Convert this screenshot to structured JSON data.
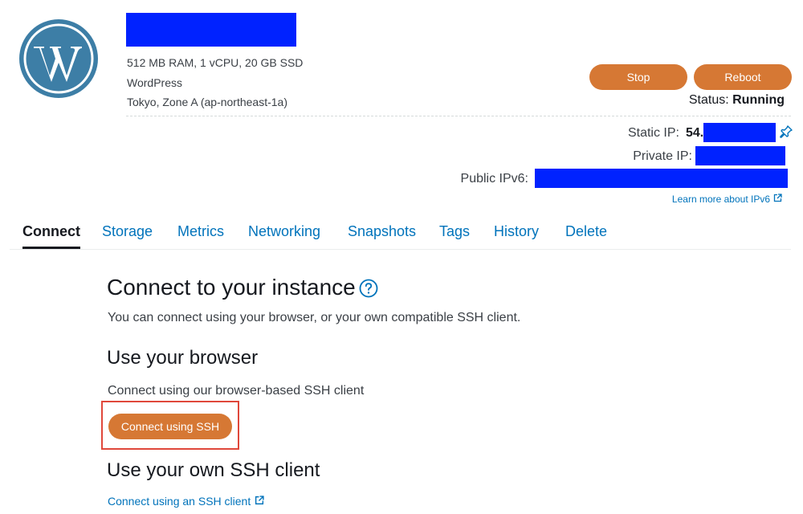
{
  "instance": {
    "specs": "512 MB RAM, 1 vCPU, 20 GB SSD",
    "blueprint": "WordPress",
    "location": "Tokyo, Zone A (ap-northeast-1a)"
  },
  "actions": {
    "stop_label": "Stop",
    "reboot_label": "Reboot"
  },
  "status": {
    "label": "Status:",
    "value": "Running"
  },
  "network": {
    "static_ip_label": "Static IP:",
    "static_ip_prefix": "54.",
    "private_ip_label": "Private IP:",
    "public_ipv6_label": "Public IPv6:",
    "learn_more_label": "Learn more about IPv6"
  },
  "tabs": [
    {
      "label": "Connect",
      "active": true
    },
    {
      "label": "Storage",
      "active": false
    },
    {
      "label": "Metrics",
      "active": false
    },
    {
      "label": "Networking",
      "active": false
    },
    {
      "label": "Snapshots",
      "active": false
    },
    {
      "label": "Tags",
      "active": false
    },
    {
      "label": "History",
      "active": false
    },
    {
      "label": "Delete",
      "active": false
    }
  ],
  "connect": {
    "title": "Connect to your instance",
    "description": "You can connect using your browser, or your own compatible SSH client.",
    "browser_heading": "Use your browser",
    "browser_description": "Connect using our browser-based SSH client",
    "ssh_button_label": "Connect using SSH",
    "own_client_heading": "Use your own SSH client",
    "own_client_link": "Connect using an SSH client"
  },
  "colors": {
    "accent": "#d67834",
    "link": "#0073bb",
    "highlight": "#e0483b",
    "wordpress_blue": "#3d7ea6"
  }
}
